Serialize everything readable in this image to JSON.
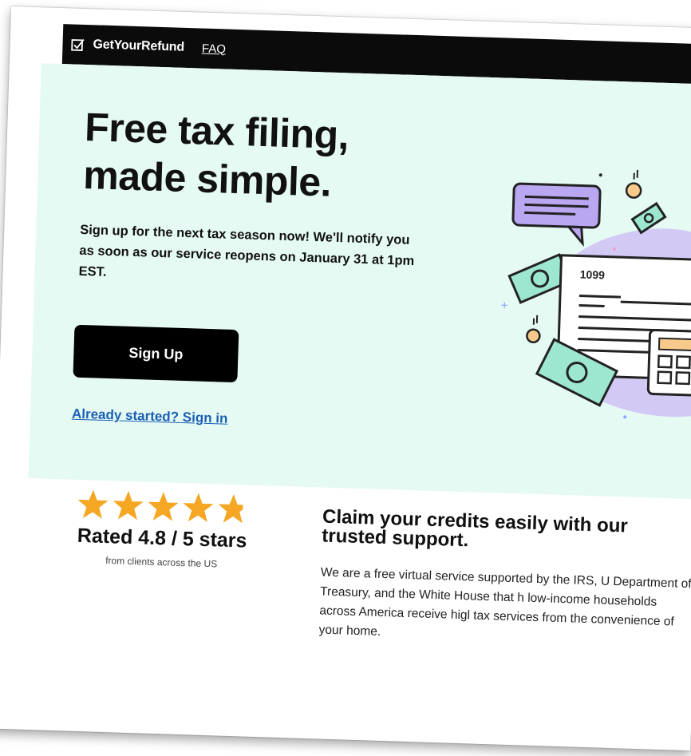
{
  "header": {
    "brand": "GetYourRefund",
    "faq_label": "FAQ"
  },
  "hero": {
    "title_line1": "Free tax filing,",
    "title_line2": "made simple.",
    "subtitle": "Sign up for the next tax season now! We'll notify you as soon as our service reopens on January 31 at 1pm EST.",
    "signup_label": "Sign Up",
    "signin_label": "Already started? Sign in",
    "form_label": "1099"
  },
  "rating": {
    "value": 4.8,
    "max": 5,
    "text": "Rated 4.8 / 5 stars",
    "subtext": "from clients across the US"
  },
  "credits": {
    "title": "Claim your credits easily with our trusted support.",
    "body": "We are a free virtual service supported by the IRS, U Department of Treasury, and the White House that h low-income households across America receive higl tax services from the convenience of your home."
  },
  "colors": {
    "hero_bg": "#e6faf4",
    "nav_bg": "#0b0b0b",
    "accent_link": "#1a5fb4",
    "star": "#f5a623",
    "bubble": "#b9a7f2"
  }
}
